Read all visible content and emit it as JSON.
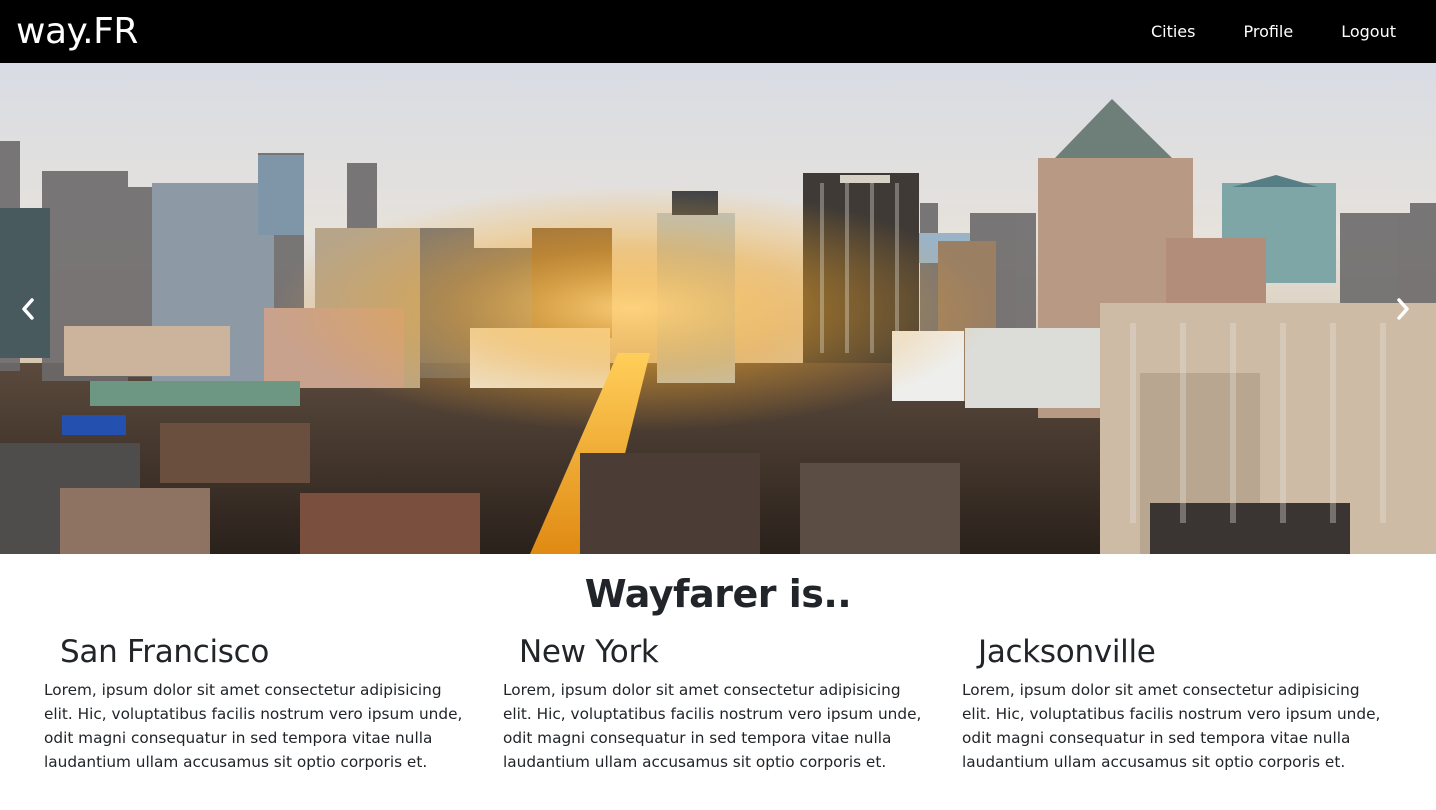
{
  "navbar": {
    "brand": "way.FR",
    "links": [
      {
        "label": "Cities"
      },
      {
        "label": "Profile"
      },
      {
        "label": "Logout"
      }
    ]
  },
  "hero": {
    "image_icon": "city-skyline-image",
    "prev_icon": "chevron-left-icon",
    "next_icon": "chevron-right-icon"
  },
  "intro": {
    "title": "Wayfarer is.."
  },
  "cities": [
    {
      "name": "San Francisco",
      "description": "Lorem, ipsum dolor sit amet consectetur adipisicing elit. Hic, voluptatibus facilis nostrum vero ipsum unde, odit magni consequatur in sed tempora vitae nulla laudantium ullam accusamus sit optio corporis et."
    },
    {
      "name": "New York",
      "description": "Lorem, ipsum dolor sit amet consectetur adipisicing elit. Hic, voluptatibus facilis nostrum vero ipsum unde, odit magni consequatur in sed tempora vitae nulla laudantium ullam accusamus sit optio corporis et."
    },
    {
      "name": "Jacksonville",
      "description": "Lorem, ipsum dolor sit amet consectetur adipisicing elit. Hic, voluptatibus facilis nostrum vero ipsum unde, odit magni consequatur in sed tempora vitae nulla laudantium ullam accusamus sit optio corporis et."
    }
  ],
  "colors": {
    "navbar_bg": "#000000",
    "nav_text": "#ffffff",
    "body_text": "#212529",
    "sunlight": "#f5a623"
  }
}
